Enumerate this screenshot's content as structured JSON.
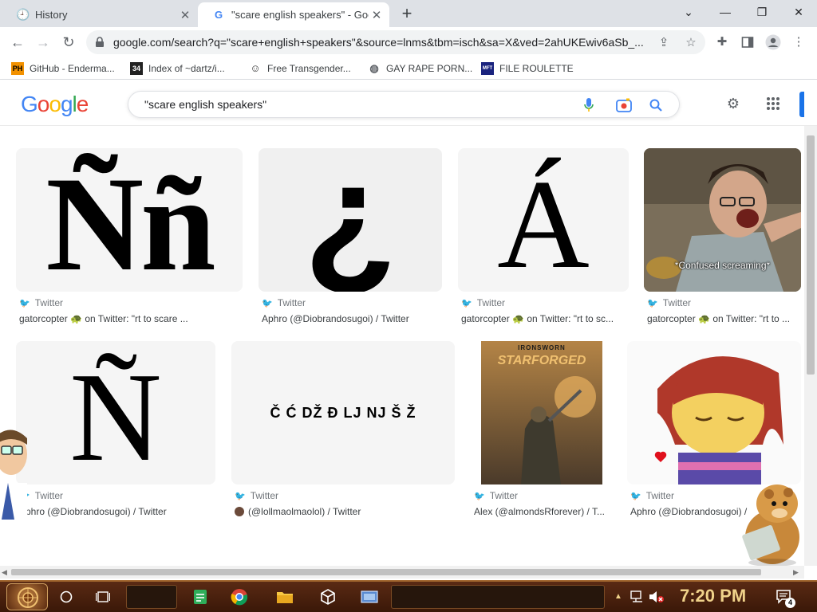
{
  "browser": {
    "tabs": [
      {
        "label": "History",
        "close": "✕"
      },
      {
        "label": "\"scare english speakers\" - Goog",
        "close": "✕"
      }
    ],
    "new_tab": "+",
    "window_controls": {
      "minimize": "—",
      "maximize": "❐",
      "close": "✕",
      "tab_search": "⌄"
    },
    "url": "google.com/search?q=\"scare+english+speakers\"&source=lnms&tbm=isch&sa=X&ved=2ahUKEwiv6aSb_..."
  },
  "bookmarks": [
    {
      "label": "GitHub - Enderma...",
      "icon": "PH"
    },
    {
      "label": "Index of ~dartz/i...",
      "icon": "34"
    },
    {
      "label": "Free Transgender...",
      "icon": ""
    },
    {
      "label": "GAY RAPE PORN...",
      "icon": ""
    },
    {
      "label": "FILE ROULETTE",
      "icon": "MFT"
    }
  ],
  "google": {
    "logo": [
      "G",
      "o",
      "o",
      "g",
      "l",
      "e"
    ],
    "logo_colors": [
      "#4285f4",
      "#ea4335",
      "#fbbc05",
      "#4285f4",
      "#34a853",
      "#ea4335"
    ],
    "query": "\"scare english speakers\""
  },
  "results": [
    {
      "glyph": "Ññ",
      "source": "Twitter",
      "title": "gatorcopter 🐢 on Twitter: \"rt to scare ..."
    },
    {
      "glyph": "¿",
      "source": "Twitter",
      "title": "Aphro (@Diobrandosugoi) / Twitter"
    },
    {
      "glyph": "Á",
      "source": "Twitter",
      "title": "gatorcopter 🐢 on Twitter: \"rt to sc..."
    },
    {
      "caption": "*Confused screaming*",
      "source": "Twitter",
      "title": "gatorcopter 🐢 on Twitter: \"rt to ..."
    },
    {
      "glyph": "Ñ",
      "source": "Twitter",
      "title": "Aphro (@Diobrandosugoi) / Twitter"
    },
    {
      "glyph": "Č Ć DŽ Đ LJ NJ Š Ž",
      "source": "Twitter",
      "title": "(@lollmaolmaolol) / Twitter"
    },
    {
      "book_line1": "IRONSWORN",
      "book_line2": "STARFORGED",
      "source": "Twitter",
      "title": "Alex (@almondsRforever) / T..."
    },
    {
      "source": "Twitter",
      "title": "Aphro (@Diobrandosugoi) / ..."
    }
  ],
  "taskbar": {
    "clock": "7:20 PM",
    "notification_count": "4"
  },
  "colors": {
    "tab_strip": "#dee1e6",
    "twitter_blue": "#1d9bf0",
    "google_blue": "#1a73e8",
    "taskbar": "#4a2010",
    "clock": "#f0d28a"
  }
}
